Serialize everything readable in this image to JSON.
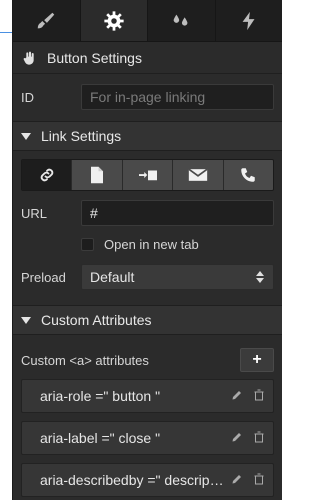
{
  "tabs": [
    {
      "icon": "brush-icon"
    },
    {
      "icon": "gear-icon",
      "active": true
    },
    {
      "icon": "droplets-icon"
    },
    {
      "icon": "lightning-icon"
    }
  ],
  "button_settings": {
    "title": "Button Settings"
  },
  "id_field": {
    "label": "ID",
    "placeholder": "For in-page linking"
  },
  "link_settings": {
    "title": "Link Settings",
    "options": [
      "link-icon",
      "page-icon",
      "section-icon",
      "email-icon",
      "phone-icon"
    ],
    "url_label": "URL",
    "url_value": "#",
    "new_tab_label": "Open in new tab",
    "preload_label": "Preload",
    "preload_value": "Default"
  },
  "custom_attributes": {
    "title": "Custom Attributes",
    "subtitle": "Custom <a> attributes",
    "add_label": "+",
    "items": [
      {
        "text": "aria-role =\" button \""
      },
      {
        "text": "aria-label =\" close \""
      },
      {
        "text": "aria-describedby =\" description\""
      }
    ]
  }
}
